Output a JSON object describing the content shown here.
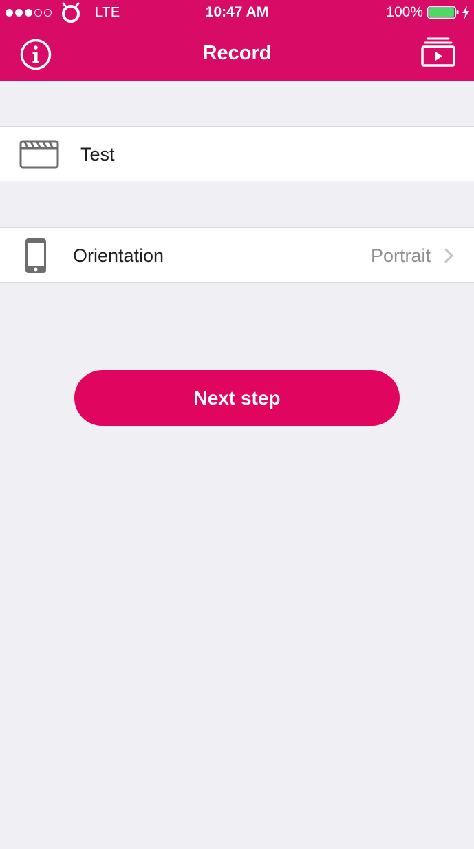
{
  "colors": {
    "brand": "#d80b66",
    "button": "#e0055f",
    "background": "#efeff4",
    "battery": "#4cd964",
    "secondary_text": "#8e8e93"
  },
  "status_bar": {
    "signal_strength": "3 of 5",
    "network": "LTE",
    "time": "10:47 AM",
    "battery_percent": "100%",
    "battery_level": 1.0,
    "charging": true
  },
  "nav_bar": {
    "title": "Record",
    "left_icon": "info-icon",
    "right_icon": "video-library-icon"
  },
  "project": {
    "icon": "clapperboard-icon",
    "name": "Test"
  },
  "orientation": {
    "icon": "smartphone-icon",
    "label": "Orientation",
    "value": "Portrait"
  },
  "actions": {
    "next_label": "Next step"
  }
}
